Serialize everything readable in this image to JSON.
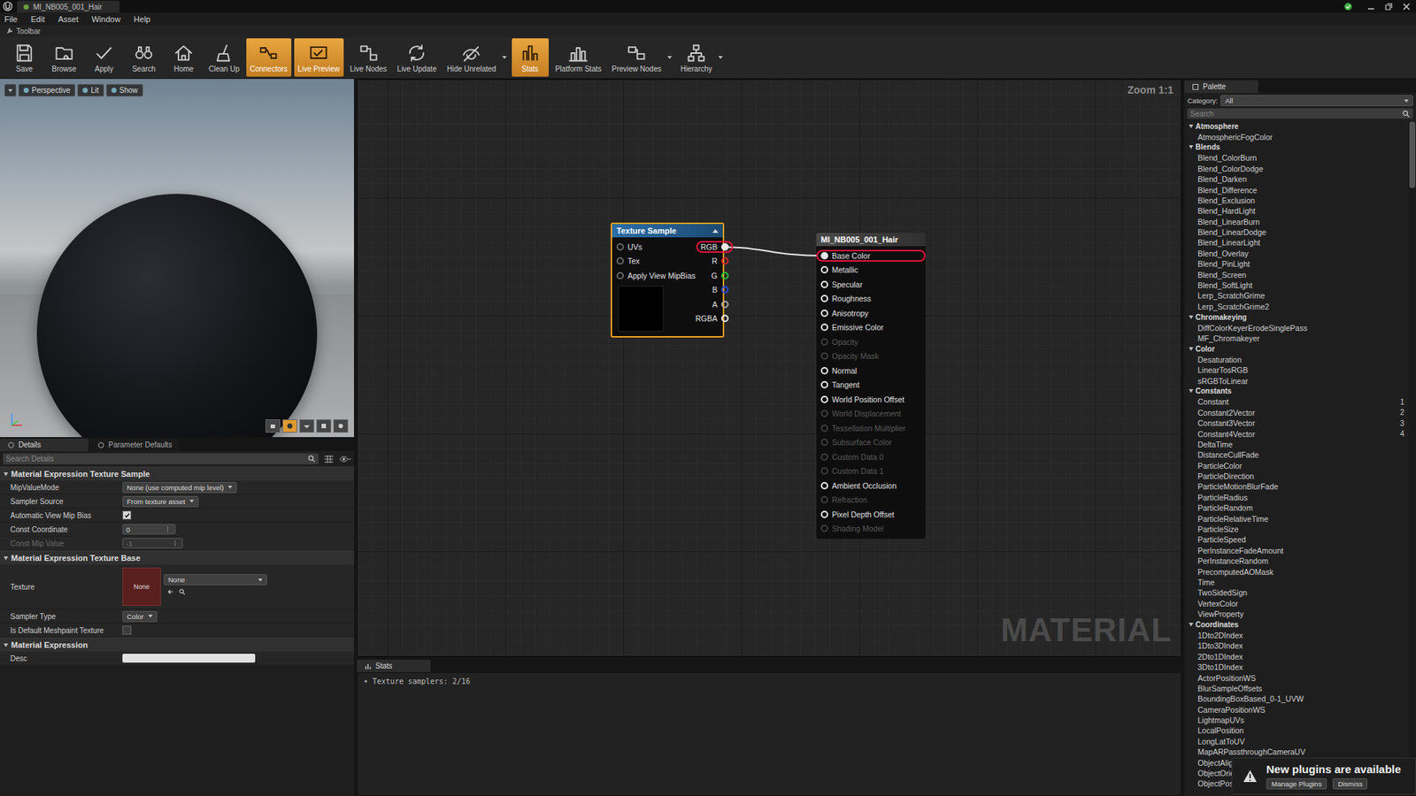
{
  "window": {
    "title": "MI_NB005_001_Hair"
  },
  "menu": [
    "File",
    "Edit",
    "Asset",
    "Window",
    "Help"
  ],
  "toolbar": {
    "label": "Toolbar",
    "buttons": [
      {
        "label": "Save",
        "active": false,
        "dropdown": false
      },
      {
        "label": "Browse",
        "active": false,
        "dropdown": false
      },
      {
        "label": "Apply",
        "active": false,
        "dropdown": false
      },
      {
        "label": "Search",
        "active": false,
        "dropdown": false
      },
      {
        "label": "Home",
        "active": false,
        "dropdown": false
      },
      {
        "label": "Clean Up",
        "active": false,
        "dropdown": false
      },
      {
        "label": "Connectors",
        "active": true,
        "dropdown": false
      },
      {
        "label": "Live Preview",
        "active": true,
        "dropdown": false
      },
      {
        "label": "Live Nodes",
        "active": false,
        "dropdown": false
      },
      {
        "label": "Live Update",
        "active": false,
        "dropdown": false
      },
      {
        "label": "Hide Unrelated",
        "active": false,
        "dropdown": true
      },
      {
        "label": "Stats",
        "active": true,
        "dropdown": false
      },
      {
        "label": "Platform Stats",
        "active": false,
        "dropdown": false
      },
      {
        "label": "Preview Nodes",
        "active": false,
        "dropdown": true
      },
      {
        "label": "Hierarchy",
        "active": false,
        "dropdown": true
      }
    ]
  },
  "viewport": {
    "buttons": [
      {
        "label": "Perspective"
      },
      {
        "label": "Lit"
      },
      {
        "label": "Show"
      }
    ]
  },
  "details": {
    "tabs": [
      {
        "label": "Details",
        "selected": true
      },
      {
        "label": "Parameter Defaults",
        "selected": false
      }
    ],
    "search_placeholder": "Search Details",
    "sections": [
      {
        "title": "Material Expression Texture Sample",
        "expanded": true,
        "rows": [
          {
            "label": "MipValueMode",
            "kind": "dropdown",
            "value": "None (use computed mip level)",
            "disabled": false
          },
          {
            "label": "Sampler Source",
            "kind": "dropdown",
            "value": "From texture asset",
            "disabled": false
          },
          {
            "label": "Automatic View Mip Bias",
            "kind": "checkbox",
            "checked": true,
            "disabled": false
          },
          {
            "label": "Const Coordinate",
            "kind": "number",
            "value": "0",
            "disabled": false
          },
          {
            "label": "Const Mip Value",
            "kind": "number",
            "value": "-1",
            "disabled": true
          }
        ]
      },
      {
        "title": "Material Expression Texture Base",
        "expanded": true,
        "rows": [
          {
            "label": "Texture",
            "kind": "texture",
            "thumbnail": "None",
            "value": "None",
            "disabled": false
          },
          {
            "label": "Sampler Type",
            "kind": "dropdown",
            "value": "Color",
            "disabled": false
          },
          {
            "label": "Is Default Meshpaint Texture",
            "kind": "checkbox",
            "checked": false,
            "disabled": false
          }
        ]
      },
      {
        "title": "Material Expression",
        "expanded": true,
        "rows": [
          {
            "label": "Desc",
            "kind": "text",
            "value": "",
            "disabled": false
          }
        ]
      }
    ]
  },
  "graph": {
    "zoom": "Zoom 1:1",
    "watermark": "MATERIAL",
    "texture_node": {
      "title": "Texture Sample",
      "selected": true,
      "inputs": [
        {
          "label": "UVs"
        },
        {
          "label": "Tex"
        },
        {
          "label": "Apply View MipBias"
        }
      ],
      "outputs": [
        {
          "label": "RGB",
          "color": "#e8e8e8",
          "connected": true,
          "highlighted": true
        },
        {
          "label": "R",
          "color": "#e02424",
          "connected": false,
          "highlighted": false
        },
        {
          "label": "G",
          "color": "#22c23a",
          "connected": false,
          "highlighted": false
        },
        {
          "label": "B",
          "color": "#2a4ae6",
          "connected": false,
          "highlighted": false
        },
        {
          "label": "A",
          "color": "#a8a8a8",
          "connected": false,
          "highlighted": false
        },
        {
          "label": "RGBA",
          "color": "#e8e8e8",
          "connected": false,
          "highlighted": false
        }
      ]
    },
    "result_node": {
      "title": "MI_NB005_001_Hair",
      "pins": [
        {
          "label": "Base Color",
          "enabled": true,
          "connected": true,
          "highlighted": true
        },
        {
          "label": "Metallic",
          "enabled": true,
          "connected": false,
          "highlighted": false
        },
        {
          "label": "Specular",
          "enabled": true,
          "connected": false,
          "highlighted": false
        },
        {
          "label": "Roughness",
          "enabled": true,
          "connected": false,
          "highlighted": false
        },
        {
          "label": "Anisotropy",
          "enabled": true,
          "connected": false,
          "highlighted": false
        },
        {
          "label": "Emissive Color",
          "enabled": true,
          "connected": false,
          "highlighted": false
        },
        {
          "label": "Opacity",
          "enabled": false,
          "connected": false,
          "highlighted": false
        },
        {
          "label": "Opacity Mask",
          "enabled": false,
          "connected": false,
          "highlighted": false
        },
        {
          "label": "Normal",
          "enabled": true,
          "connected": false,
          "highlighted": false
        },
        {
          "label": "Tangent",
          "enabled": true,
          "connected": false,
          "highlighted": false
        },
        {
          "label": "World Position Offset",
          "enabled": true,
          "connected": false,
          "highlighted": false
        },
        {
          "label": "World Displacement",
          "enabled": false,
          "connected": false,
          "highlighted": false
        },
        {
          "label": "Tessellation Multiplier",
          "enabled": false,
          "connected": false,
          "highlighted": false
        },
        {
          "label": "Subsurface Color",
          "enabled": false,
          "connected": false,
          "highlighted": false
        },
        {
          "label": "Custom Data 0",
          "enabled": false,
          "connected": false,
          "highlighted": false
        },
        {
          "label": "Custom Data 1",
          "enabled": false,
          "connected": false,
          "highlighted": false
        },
        {
          "label": "Ambient Occlusion",
          "enabled": true,
          "connected": false,
          "highlighted": false
        },
        {
          "label": "Refraction",
          "enabled": false,
          "connected": false,
          "highlighted": false
        },
        {
          "label": "Pixel Depth Offset",
          "enabled": true,
          "connected": false,
          "highlighted": false
        },
        {
          "label": "Shading Model",
          "enabled": false,
          "connected": false,
          "highlighted": false
        }
      ]
    }
  },
  "stats": {
    "tab": "Stats",
    "lines": [
      {
        "bullet": "•",
        "text": "Texture samplers: 2/16"
      }
    ]
  },
  "palette": {
    "tab": "Palette",
    "category_label": "Category:",
    "category_value": "All",
    "search_placeholder": "Search",
    "categories": [
      {
        "name": "Atmosphere",
        "expanded": true,
        "items": [
          {
            "label": "AtmosphericFogColor"
          }
        ]
      },
      {
        "name": "Blends",
        "expanded": true,
        "items": [
          {
            "label": "Blend_ColorBurn"
          },
          {
            "label": "Blend_ColorDodge"
          },
          {
            "label": "Blend_Darken"
          },
          {
            "label": "Blend_Difference"
          },
          {
            "label": "Blend_Exclusion"
          },
          {
            "label": "Blend_HardLight"
          },
          {
            "label": "Blend_LinearBurn"
          },
          {
            "label": "Blend_LinearDodge"
          },
          {
            "label": "Blend_LinearLight"
          },
          {
            "label": "Blend_Overlay"
          },
          {
            "label": "Blend_PinLight"
          },
          {
            "label": "Blend_Screen"
          },
          {
            "label": "Blend_SoftLight"
          },
          {
            "label": "Lerp_ScratchGrime"
          },
          {
            "label": "Lerp_ScratchGrime2"
          }
        ]
      },
      {
        "name": "Chromakeying",
        "expanded": true,
        "items": [
          {
            "label": "DiffColorKeyerErodeSinglePass"
          },
          {
            "label": "MF_Chromakeyer"
          }
        ]
      },
      {
        "name": "Color",
        "expanded": true,
        "items": [
          {
            "label": "Desaturation"
          },
          {
            "label": "LinearTosRGB"
          },
          {
            "label": "sRGBToLinear"
          }
        ]
      },
      {
        "name": "Constants",
        "expanded": true,
        "items": [
          {
            "label": "Constant",
            "hotkey": "1"
          },
          {
            "label": "Constant2Vector",
            "hotkey": "2"
          },
          {
            "label": "Constant3Vector",
            "hotkey": "3"
          },
          {
            "label": "Constant4Vector",
            "hotkey": "4"
          },
          {
            "label": "DeltaTime"
          },
          {
            "label": "DistanceCullFade"
          },
          {
            "label": "ParticleColor"
          },
          {
            "label": "ParticleDirection"
          },
          {
            "label": "ParticleMotionBlurFade"
          },
          {
            "label": "ParticleRadius"
          },
          {
            "label": "ParticleRandom"
          },
          {
            "label": "ParticleRelativeTime"
          },
          {
            "label": "ParticleSize"
          },
          {
            "label": "ParticleSpeed"
          },
          {
            "label": "PerInstanceFadeAmount"
          },
          {
            "label": "PerInstanceRandom"
          },
          {
            "label": "PrecomputedAOMask"
          },
          {
            "label": "Time"
          },
          {
            "label": "TwoSidedSign"
          },
          {
            "label": "VertexColor"
          },
          {
            "label": "ViewProperty"
          }
        ]
      },
      {
        "name": "Coordinates",
        "expanded": true,
        "items": [
          {
            "label": "1Dto2DIndex"
          },
          {
            "label": "1Dto3DIndex"
          },
          {
            "label": "2Dto1DIndex"
          },
          {
            "label": "3Dto1DIndex"
          },
          {
            "label": "ActorPositionWS"
          },
          {
            "label": "BlurSampleOffsets"
          },
          {
            "label": "BoundingBoxBased_0-1_UVW"
          },
          {
            "label": "CameraPositionWS"
          },
          {
            "label": "LightmapUVs"
          },
          {
            "label": "LocalPosition"
          },
          {
            "label": "LongLatToUV"
          },
          {
            "label": "MapARPassthroughCameraUV"
          },
          {
            "label": "ObjectAlig"
          },
          {
            "label": "ObjectOrie"
          },
          {
            "label": "ObjectPosi"
          }
        ]
      }
    ]
  },
  "notification": {
    "message": "New plugins are available",
    "buttons": [
      "Manage Plugins",
      "Dismiss"
    ]
  }
}
